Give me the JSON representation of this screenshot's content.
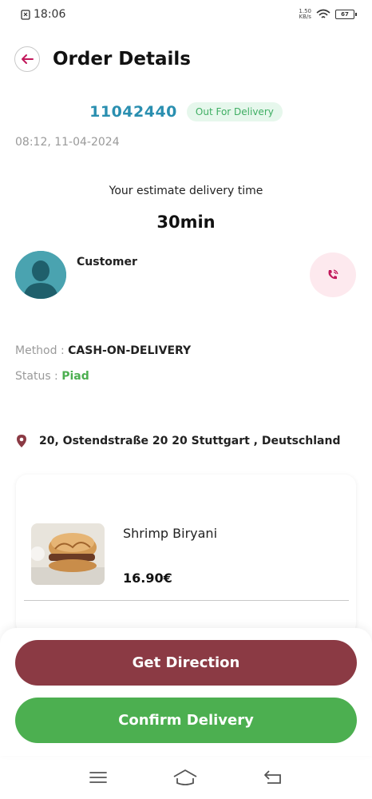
{
  "status_bar": {
    "time": "18:06",
    "net_speed_value": "1.50",
    "net_speed_unit": "KB/s",
    "battery": "67"
  },
  "header": {
    "title": "Order Details"
  },
  "order": {
    "id": "11042440",
    "status": "Out For Delivery",
    "datetime": "08:12, 11-04-2024"
  },
  "estimate": {
    "label": "Your estimate delivery time",
    "time": "30min"
  },
  "customer": {
    "name": "Customer"
  },
  "payment": {
    "method_label": "Method :",
    "method_value": "CASH-ON-DELIVERY",
    "status_label": "Status :",
    "status_value": "Piad"
  },
  "address": "20, Ostendstraße 20 20 Stuttgart , Deutschland",
  "items": [
    {
      "name": "Shrimp Biryani",
      "price": "16.90€"
    }
  ],
  "actions": {
    "direction": "Get Direction",
    "confirm": "Confirm Delivery"
  },
  "colors": {
    "accent_red": "#8b3a44",
    "accent_green": "#4caf50",
    "order_id_blue": "#2a8fb0"
  }
}
